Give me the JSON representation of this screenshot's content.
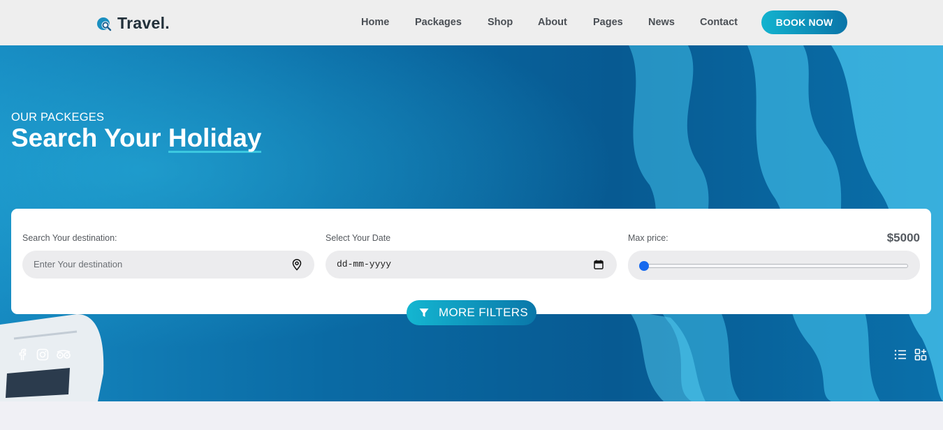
{
  "brand": {
    "name": "Travel.",
    "icon": "search-globe-icon"
  },
  "nav": {
    "items": [
      {
        "label": "Home"
      },
      {
        "label": "Packages"
      },
      {
        "label": "Shop"
      },
      {
        "label": "About"
      },
      {
        "label": "Pages"
      },
      {
        "label": "News"
      },
      {
        "label": "Contact"
      }
    ],
    "cta_label": "BOOK NOW"
  },
  "hero": {
    "subtitle": "OUR PACKEGES",
    "title_part1": "Search Your ",
    "title_highlight": "Holiday"
  },
  "search": {
    "destination_label": "Search Your destination:",
    "destination_placeholder": "Enter Your destination",
    "date_label": "Select Your Date",
    "date_value": "dd-mm-yyyy",
    "price_label": "Max price:",
    "price_value": "$5000",
    "price_slider_fraction": 0,
    "more_filters_label": "MORE FILTERS"
  },
  "social_icons": [
    "facebook-icon",
    "instagram-icon",
    "tripadvisor-icon"
  ],
  "view_icons": [
    "list-view-icon",
    "grid-view-icon"
  ],
  "colors": {
    "accent_start": "#13b3cf",
    "accent_end": "#0a74a8",
    "slider_thumb": "#1669ee",
    "title_underline": "#3cc8e0"
  }
}
